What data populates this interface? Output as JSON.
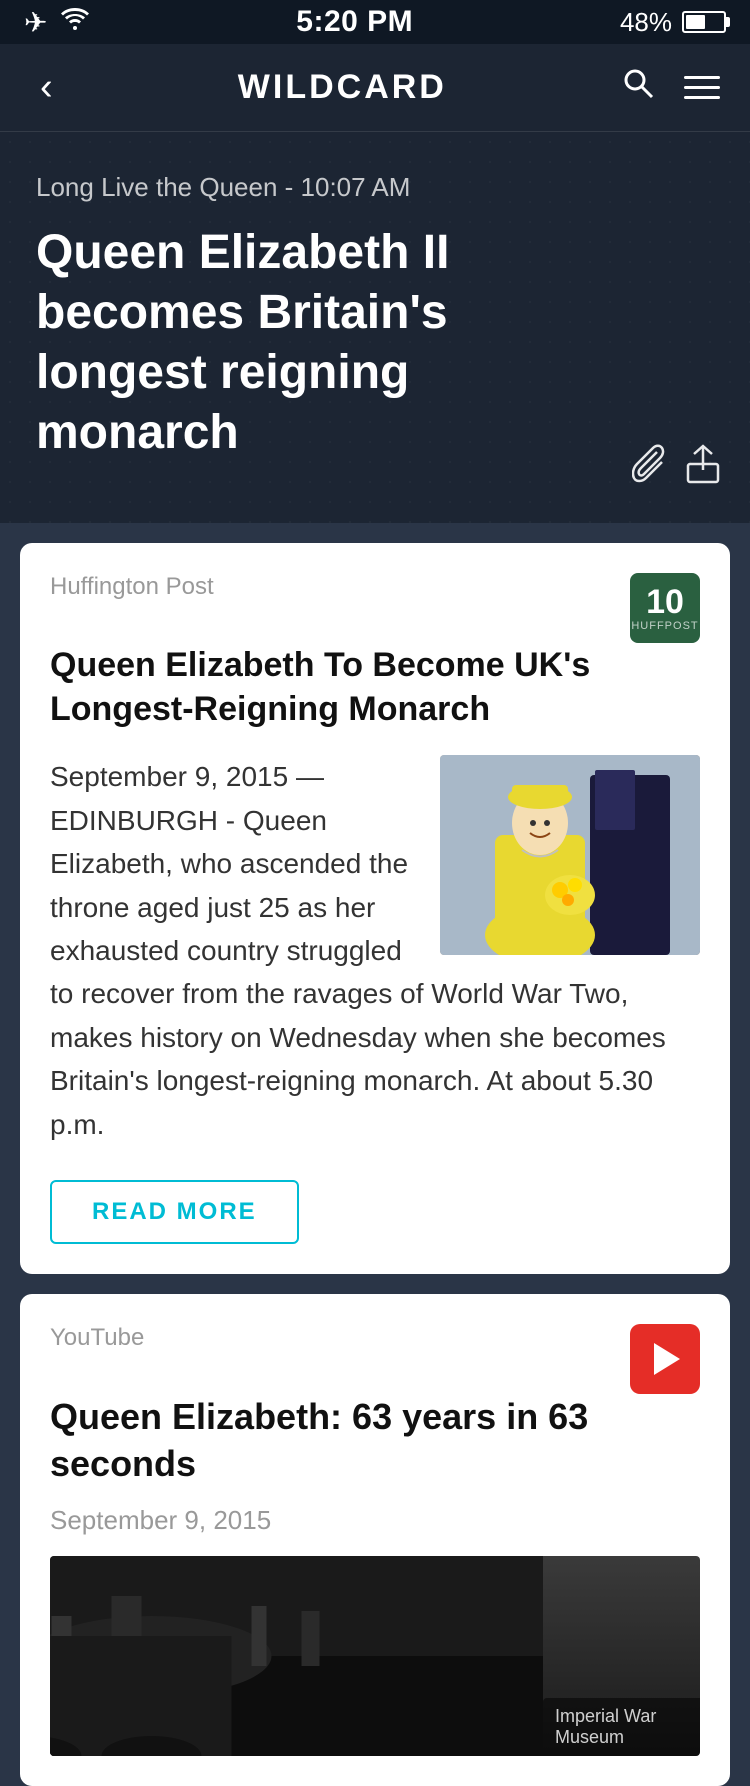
{
  "statusBar": {
    "time": "5:20 PM",
    "battery": "48%",
    "batteryLevel": 48
  },
  "navBar": {
    "title": "WILDCARD",
    "backLabel": "‹"
  },
  "hero": {
    "meta": "Long Live the Queen - 10:07 AM",
    "title": "Queen Elizabeth II becomes Britain's longest reigning monarch"
  },
  "card1": {
    "source": "Huffington Post",
    "badge": "10",
    "badgeSub": "HUFFPOST",
    "title": "Queen Elizabeth To Become UK's Longest-Reigning Monarch",
    "text": "September 9, 2015 — EDINBURGH - Queen Elizabeth, who ascended the throne aged just 25 as her exhausted country struggled to recover from the ravages of World War Two, makes history on Wednesday when she becomes Britain's longest-reigning monarch. At about 5.30 p.m.",
    "readMore": "READ MORE"
  },
  "card2": {
    "source": "YouTube",
    "title": "Queen Elizabeth: 63 years in 63 seconds",
    "date": "September 9, 2015",
    "thumbnailLabel": "Imperial War Museum"
  }
}
